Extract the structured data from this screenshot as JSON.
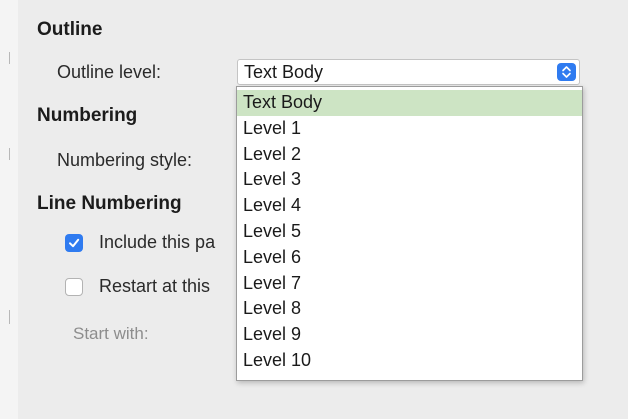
{
  "outline": {
    "heading": "Outline",
    "level_label": "Outline level:",
    "level_value": "Text Body",
    "level_options": [
      "Text Body",
      "Level 1",
      "Level 2",
      "Level 3",
      "Level 4",
      "Level 5",
      "Level 6",
      "Level 7",
      "Level 8",
      "Level 9",
      "Level 10"
    ],
    "selected_option": "Text Body"
  },
  "numbering": {
    "heading": "Numbering",
    "style_label": "Numbering style:"
  },
  "line_numbering": {
    "heading": "Line Numbering",
    "include_label": "Include this pa",
    "include_checked": true,
    "restart_label": "Restart at this",
    "restart_checked": false,
    "start_with_label": "Start with:"
  },
  "colors": {
    "accent": "#2f7bf0",
    "selected_row": "#cde4c4",
    "disabled_text": "#8d8d8d"
  },
  "icons": {
    "stepper": "chevron-up-down-icon",
    "check": "checkmark-icon"
  }
}
